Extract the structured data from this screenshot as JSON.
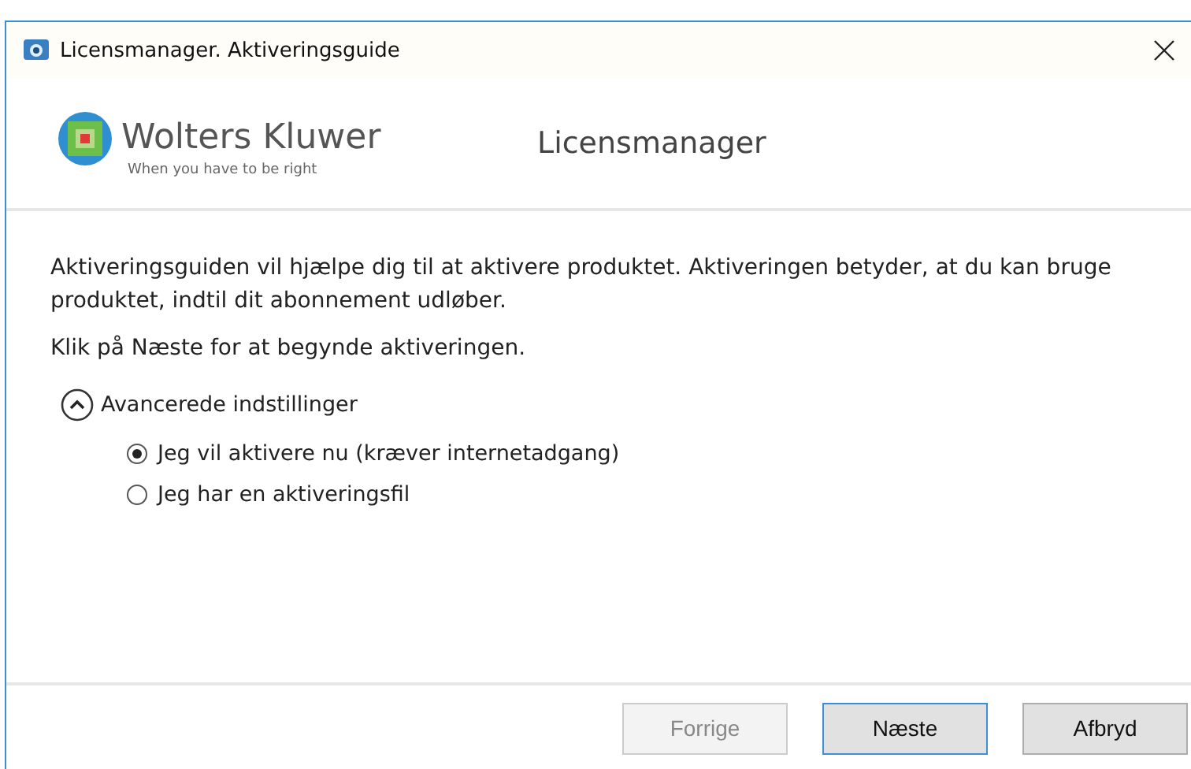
{
  "window": {
    "title": "Licensmanager. Aktiveringsguide"
  },
  "header": {
    "brand": "Wolters Kluwer",
    "tagline": "When you have to be right",
    "title": "Licensmanager"
  },
  "intro": "Aktiveringsguiden vil hjælpe dig til at aktivere produktet. Aktiveringen betyder, at du kan bruge produktet, indtil dit abonnement udløber.",
  "hint": "Klik på Næste for at begynde aktiveringen.",
  "advanced": {
    "label": "Avancerede indstillinger",
    "expanded": true,
    "options": [
      {
        "label": "Jeg vil aktivere nu (kræver internetadgang)",
        "selected": true
      },
      {
        "label": "Jeg har en aktiveringsfil",
        "selected": false
      }
    ]
  },
  "buttons": [
    {
      "label": "Forrige",
      "disabled": true,
      "default": false
    },
    {
      "label": "Næste",
      "disabled": false,
      "default": true
    },
    {
      "label": "Afbryd",
      "disabled": false,
      "default": false
    }
  ]
}
